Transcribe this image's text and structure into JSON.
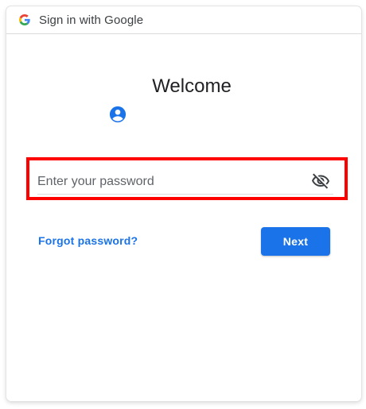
{
  "header": {
    "title": "Sign in with Google",
    "logo_icon": "google-g-icon"
  },
  "main": {
    "heading": "Welcome",
    "avatar_icon": "account-circle-icon",
    "password_field": {
      "placeholder": "Enter your password",
      "value": "",
      "visibility_icon": "eye-off-icon"
    },
    "forgot_link": "Forgot password?",
    "next_button": "Next"
  },
  "colors": {
    "accent": "#1a73e8",
    "highlight": "#ff0000",
    "text": "#202124"
  }
}
